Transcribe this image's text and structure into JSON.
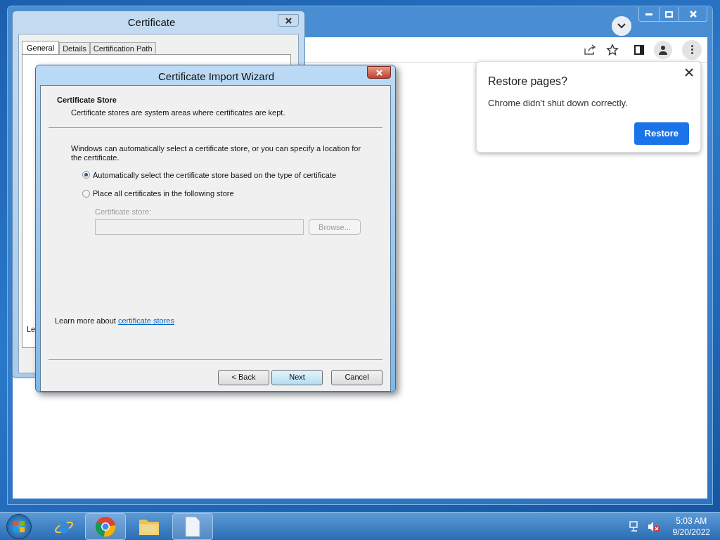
{
  "browser": {
    "popup": {
      "title": "Restore pages?",
      "message": "Chrome didn't shut down correctly.",
      "button": "Restore"
    }
  },
  "certificate_dialog": {
    "title": "Certificate",
    "tabs": [
      {
        "label": "General",
        "selected": true
      },
      {
        "label": "Details",
        "selected": false
      },
      {
        "label": "Certification Path",
        "selected": false
      }
    ],
    "partial_text": "Le"
  },
  "wizard": {
    "title": "Certificate Import Wizard",
    "heading": "Certificate Store",
    "subheading": "Certificate stores are system areas where certificates are kept.",
    "description": "Windows can automatically select a certificate store, or you can specify a location for the certificate.",
    "options": [
      {
        "label": "Automatically select the certificate store based on the type of certificate",
        "selected": true
      },
      {
        "label": "Place all certificates in the following store",
        "selected": false
      }
    ],
    "store_label": "Certificate store:",
    "store_disabled": true,
    "browse_button": "Browse...",
    "learn_more": "Learn more about",
    "learn_more_link": "certificate stores",
    "buttons": [
      {
        "label": "< Back",
        "hovered": false
      },
      {
        "label": "Next",
        "hovered": true
      },
      {
        "label": "Cancel",
        "hovered": false
      }
    ]
  },
  "taskbar": {
    "time": "5:03 AM",
    "date": "9/20/2022"
  }
}
